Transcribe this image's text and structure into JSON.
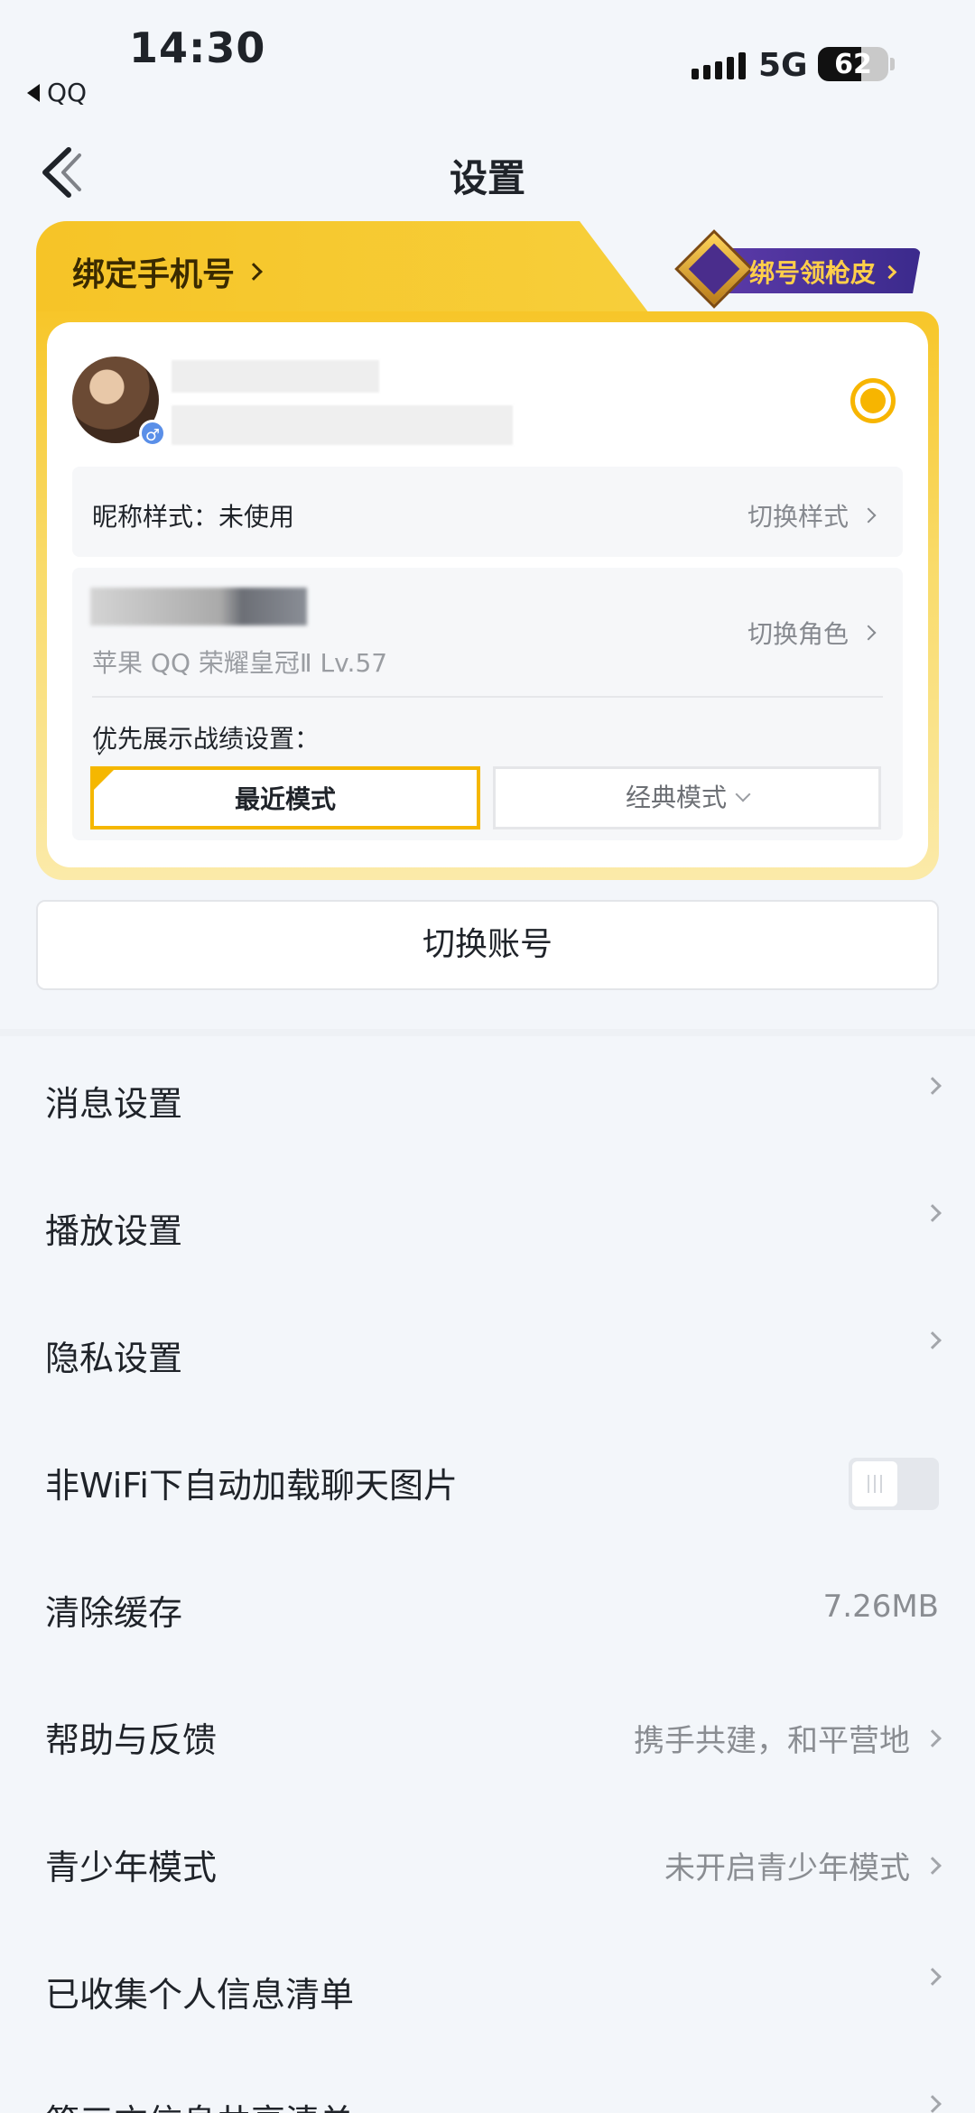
{
  "status_bar": {
    "time": "14:30",
    "back_app": "QQ",
    "network": "5G",
    "battery": "62",
    "battery_level": 0.62
  },
  "nav": {
    "title": "设置"
  },
  "account_card": {
    "bind_phone_label": "绑定手机号",
    "promo_label": "绑号领枪皮",
    "nickname_style_label": "昵称样式：未使用",
    "switch_style_label": "切换样式",
    "role_info": "苹果 QQ  荣耀皇冠Ⅱ  Lv.57",
    "switch_role_label": "切换角色",
    "priority_label": "优先展示战绩设置：",
    "mode_recent": "最近模式",
    "mode_classic": "经典模式",
    "selected_mode": "最近模式"
  },
  "switch_account": {
    "label": "切换账号"
  },
  "settings_list": [
    {
      "label": "消息设置",
      "value": "",
      "type": "link"
    },
    {
      "label": "播放设置",
      "value": "",
      "type": "link"
    },
    {
      "label": "隐私设置",
      "value": "",
      "type": "link"
    },
    {
      "label": "非WiFi下自动加载聊天图片",
      "value": "",
      "type": "toggle",
      "on": false
    },
    {
      "label": "清除缓存",
      "value": "7.26MB",
      "type": "value"
    },
    {
      "label": "帮助与反馈",
      "value": "携手共建，和平营地",
      "type": "link"
    },
    {
      "label": "青少年模式",
      "value": "未开启青少年模式",
      "type": "link"
    },
    {
      "label": "已收集个人信息清单",
      "value": "",
      "type": "link"
    },
    {
      "label": "第三方信息共享清单",
      "value": "",
      "type": "link"
    }
  ],
  "colors": {
    "accent": "#f7b500",
    "card_gold": "#f6c427",
    "background": "#f3f6fa"
  }
}
